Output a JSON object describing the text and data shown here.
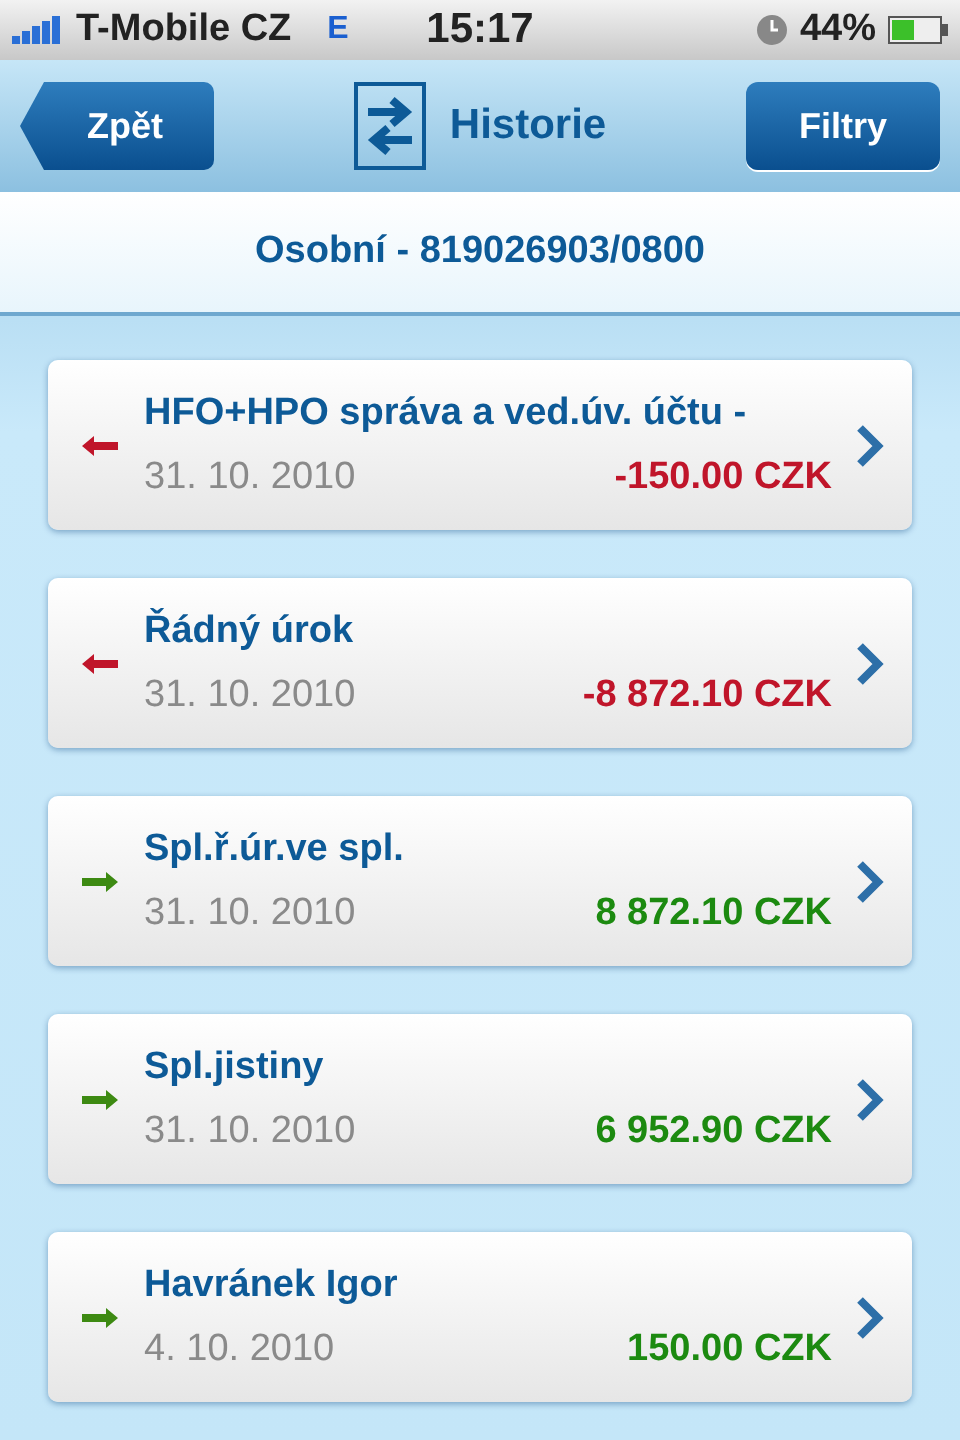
{
  "status_bar": {
    "carrier": "T-Mobile CZ",
    "network": "E",
    "time": "15:17",
    "battery": "44%"
  },
  "nav": {
    "back": "Zpět",
    "title": "Historie",
    "filter": "Filtry"
  },
  "account": "Osobní - 819026903/0800",
  "transactions": [
    {
      "kind": "out",
      "title": "HFO+HPO správa a ved.úv. účtu -",
      "date": "31. 10. 2010",
      "amount": "-150.00 CZK"
    },
    {
      "kind": "out",
      "title": "Řádný úrok",
      "date": "31. 10. 2010",
      "amount": "-8 872.10 CZK"
    },
    {
      "kind": "in",
      "title": "Spl.ř.úr.ve spl.",
      "date": "31. 10. 2010",
      "amount": "8 872.10 CZK"
    },
    {
      "kind": "in",
      "title": "Spl.jistiny",
      "date": "31. 10. 2010",
      "amount": "6 952.90 CZK"
    },
    {
      "kind": "in",
      "title": "Havránek Igor",
      "date": "4. 10. 2010",
      "amount": "150.00 CZK"
    }
  ]
}
